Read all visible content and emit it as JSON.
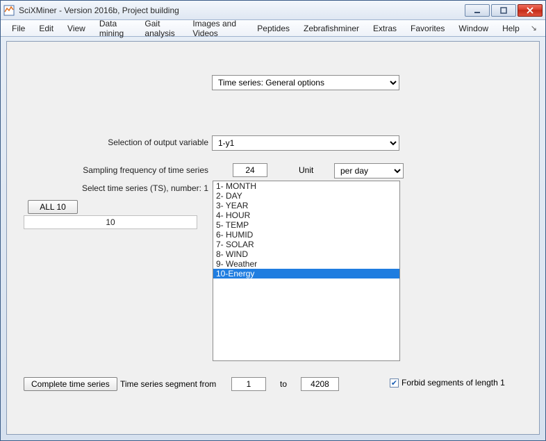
{
  "window": {
    "title": "SciXMiner - Version 2016b, Project building"
  },
  "menu": {
    "items": [
      "File",
      "Edit",
      "View",
      "Data mining",
      "Gait analysis",
      "Images and Videos",
      "Peptides",
      "Zebrafishminer",
      "Extras",
      "Favorites",
      "Window",
      "Help"
    ]
  },
  "panel": {
    "top_select": "Time series: General options",
    "output_var_label": "Selection of output variable",
    "output_var_value": "1-y1",
    "sampling_label": "Sampling frequency of time series",
    "sampling_value": "24",
    "unit_label": "Unit",
    "unit_value": "per day",
    "select_ts_label": "Select time series (TS), number: 1",
    "all_button": "ALL 10",
    "count_value": "10",
    "ts_items": [
      "1- MONTH",
      "2- DAY",
      "3- YEAR",
      "4- HOUR",
      "5- TEMP",
      "6- HUMID",
      "7- SOLAR",
      "8- WIND",
      "9- Weather",
      "10-Energy"
    ],
    "ts_selected_index": 9,
    "complete_button": "Complete time series",
    "segment_from_label": "Time series segment from",
    "segment_from_value": "1",
    "segment_to_label": "to",
    "segment_to_value": "4208",
    "forbid_checked": true,
    "forbid_label": "Forbid segments of length 1"
  }
}
